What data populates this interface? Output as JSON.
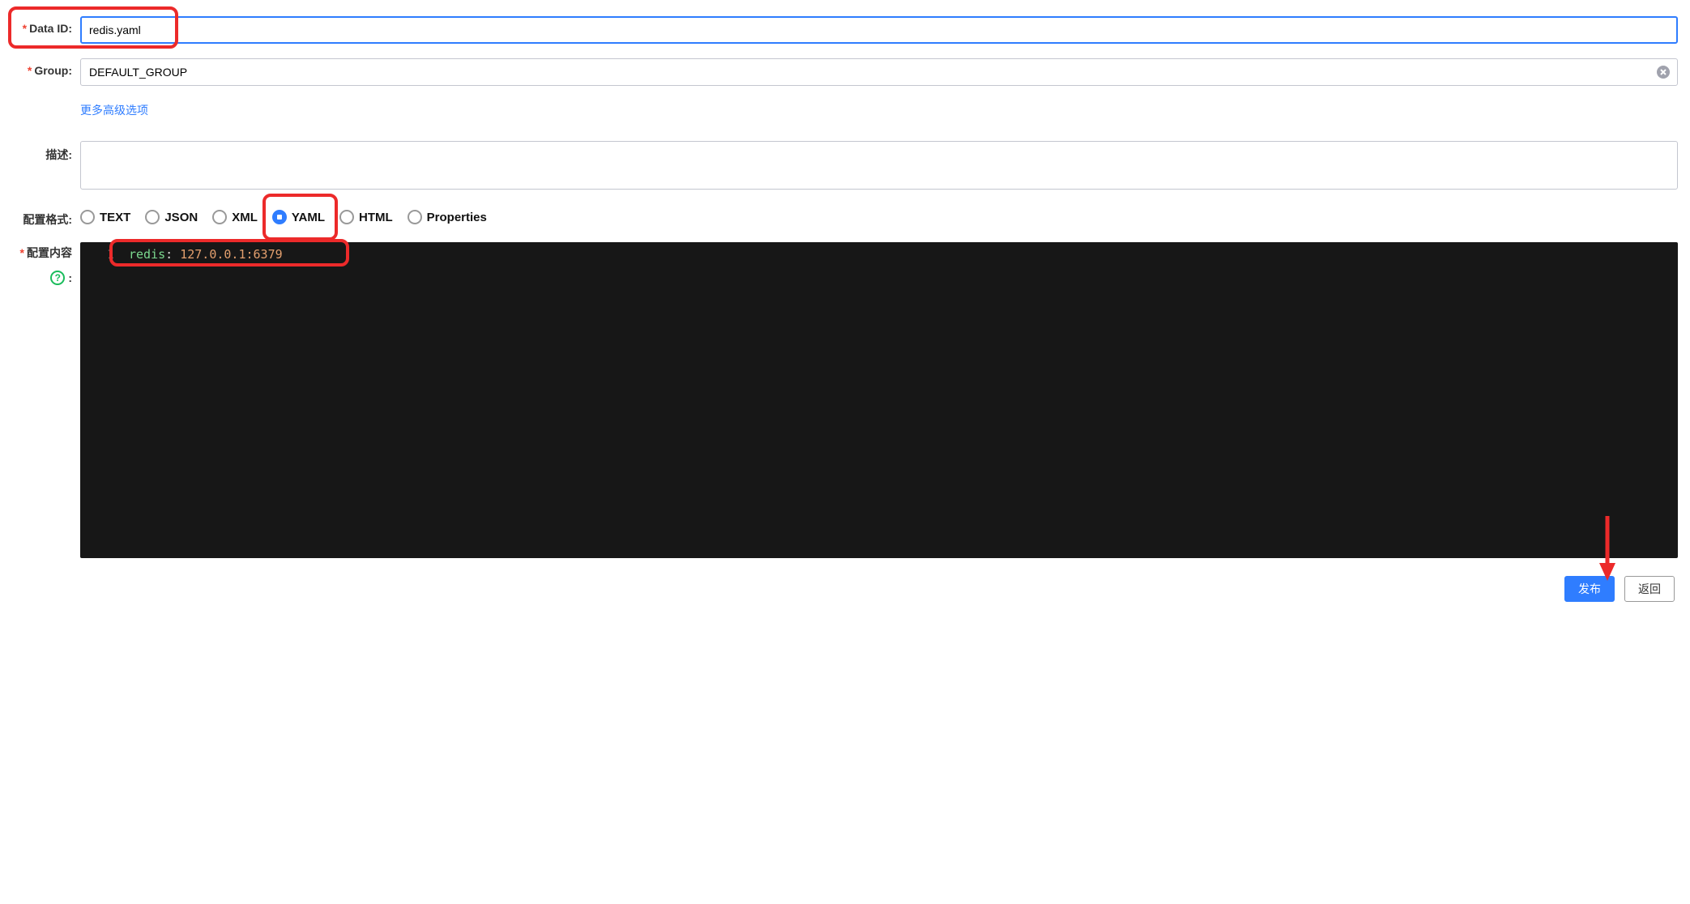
{
  "form": {
    "data_id": {
      "label": "Data ID:",
      "value": "redis.yaml"
    },
    "group": {
      "label": "Group:",
      "value": "DEFAULT_GROUP"
    },
    "more_options": "更多高级选项",
    "description": {
      "label": "描述:",
      "value": ""
    },
    "format": {
      "label": "配置格式:",
      "options": [
        "TEXT",
        "JSON",
        "XML",
        "YAML",
        "HTML",
        "Properties"
      ],
      "selected": "YAML"
    },
    "content": {
      "label": "配置内容",
      "code_key": "redis",
      "code_value": "127.0.0.1:6379"
    }
  },
  "buttons": {
    "publish": "发布",
    "back": "返回"
  },
  "icons": {
    "help": "?",
    "colon": ":"
  }
}
